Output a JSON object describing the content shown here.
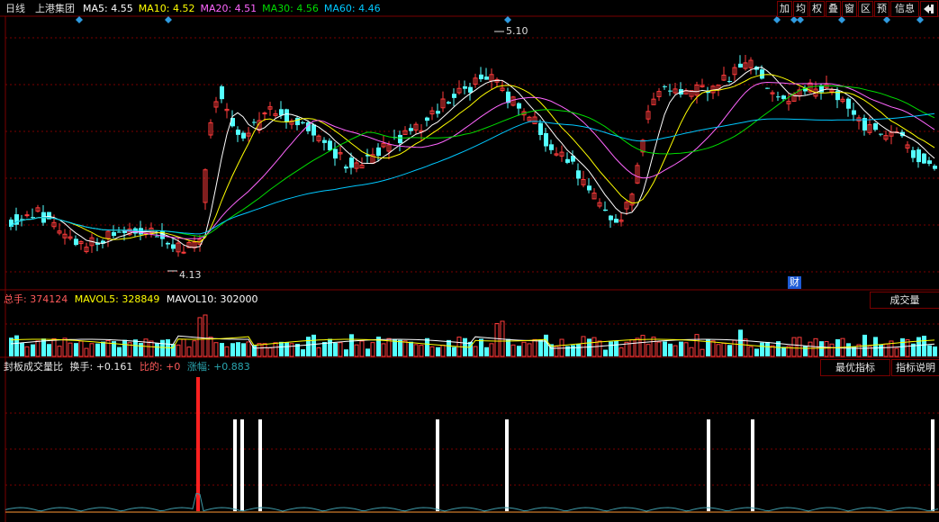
{
  "header": {
    "period": "日线",
    "stock_name": "上港集团",
    "ma": [
      {
        "label": "MA5:",
        "value": "4.55",
        "color": "#ffffff"
      },
      {
        "label": "MA10:",
        "value": "4.52",
        "color": "#ffff00"
      },
      {
        "label": "MA20:",
        "value": "4.51",
        "color": "#ff66ff"
      },
      {
        "label": "MA30:",
        "value": "4.56",
        "color": "#00dd00"
      },
      {
        "label": "MA60:",
        "value": "4.46",
        "color": "#00c8ff"
      }
    ],
    "buttons": [
      "加",
      "均",
      "权",
      "叠",
      "窗",
      "区",
      "预",
      "信息"
    ],
    "exit_icon": "exit-icon"
  },
  "price_panel": {
    "high_label": "5.10",
    "low_label": "4.13",
    "event_marker": "财"
  },
  "volume_panel": {
    "total_label": "总手:",
    "total_value": "374124",
    "mavol5_label": "MAVOL5:",
    "mavol5_value": "328849",
    "mavol10_label": "MAVOL10:",
    "mavol10_value": "302000",
    "button": "成交量"
  },
  "indicator_panel": {
    "name": "封板成交量比",
    "turnover_label": "换手:",
    "turnover_value": "+0.161",
    "ratio_label": "比的:",
    "ratio_value": "+0",
    "change_label": "涨幅:",
    "change_value": "+0.883",
    "btn_best": "最优指标",
    "btn_help": "指标说明"
  },
  "colors": {
    "up": "#ff3b3b",
    "down": "#54ffff",
    "grid": "#7a0000",
    "ma5": "#ffffff",
    "ma10": "#ffff00",
    "ma20": "#ff66ff",
    "ma30": "#00dd00",
    "ma60": "#00c8ff"
  }
}
